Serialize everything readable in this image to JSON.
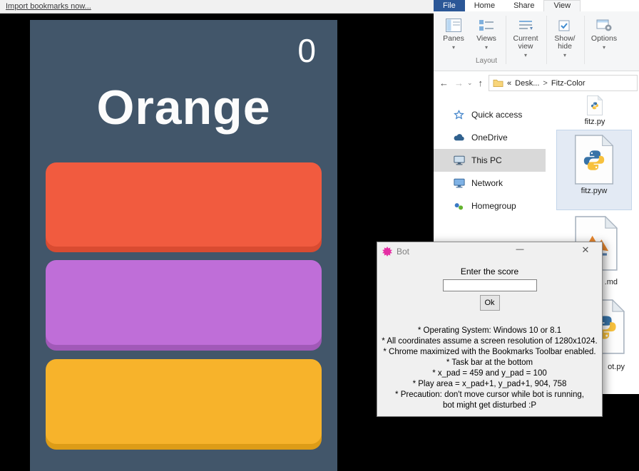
{
  "bookmarks_bar": {
    "import_link": "Import bookmarks now..."
  },
  "game": {
    "score": "0",
    "word": "Orange",
    "colors": {
      "background": "#42566a",
      "buttons": [
        {
          "name": "tomato",
          "fill": "#f15b3f",
          "edge": "#d94b31"
        },
        {
          "name": "orchid",
          "fill": "#bf6ed8",
          "edge": "#a159b8"
        },
        {
          "name": "amber",
          "fill": "#f7b32b",
          "edge": "#dd9c17"
        }
      ]
    }
  },
  "explorer": {
    "tabs": [
      {
        "label": "File"
      },
      {
        "label": "Home"
      },
      {
        "label": "Share"
      },
      {
        "label": "View"
      }
    ],
    "ribbon": {
      "buttons": [
        {
          "label": "Panes",
          "arrow": "▾"
        },
        {
          "label": "Views",
          "arrow": "▾"
        },
        {
          "label": "Current view",
          "arrow": "▾"
        },
        {
          "label": "Show/ hide",
          "arrow": "▾"
        },
        {
          "label": "Options",
          "arrow": "▾"
        }
      ],
      "group_caption": "Layout"
    },
    "address": {
      "back_icon": "←",
      "forward_icon": "→",
      "dropdown_icon": "⌄",
      "up_icon": "↑",
      "breadcrumb_prefix": "«",
      "crumb1": "Desk...",
      "separator": ">",
      "crumb2": "Fitz-Color"
    },
    "nav": [
      {
        "label": "Quick access"
      },
      {
        "label": "OneDrive"
      },
      {
        "label": "This PC"
      },
      {
        "label": "Network"
      },
      {
        "label": "Homegroup"
      }
    ],
    "files": [
      {
        "label": "fitz.py"
      },
      {
        "label": "fitz.pyw"
      },
      {
        "label": ".md"
      },
      {
        "label": "ot.py"
      }
    ]
  },
  "dialog": {
    "title": "Bot",
    "minimize": "—",
    "close": "✕",
    "prompt": "Enter the score",
    "input_value": "",
    "ok_label": "Ok",
    "notes": [
      "* Operating System: Windows 10 or 8.1",
      "* All coordinates assume a screen resolution of 1280x1024.",
      "* Chrome maximized with the Bookmarks Toolbar enabled.",
      "* Task bar at the bottom",
      "* x_pad = 459 and y_pad = 100",
      "* Play area =  x_pad+1, y_pad+1, 904, 758",
      "* Precaution: don't move cursor while bot is running,",
      "bot might get disturbed :P"
    ]
  }
}
